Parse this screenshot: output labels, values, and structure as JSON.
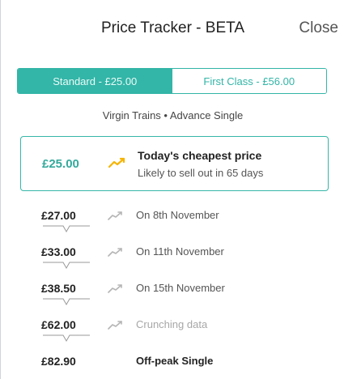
{
  "header": {
    "title": "Price Tracker - BETA",
    "close_label": "Close"
  },
  "tabs": [
    {
      "label": "Standard - £25.00",
      "active": true
    },
    {
      "label": "First Class - £56.00",
      "active": false
    }
  ],
  "subtitle": "Virgin Trains • Advance Single",
  "cheapest": {
    "price": "£25.00",
    "heading": "Today's cheapest price",
    "subtext": "Likely to sell out in 65 days",
    "icon": "trend-up-icon",
    "icon_color": "#f5b400"
  },
  "price_rows": [
    {
      "price": "£27.00",
      "label": "On 8th November",
      "icon": "trend-up-icon"
    },
    {
      "price": "£33.00",
      "label": "On 11th November",
      "icon": "trend-up-icon"
    },
    {
      "price": "£38.50",
      "label": "On 15th November",
      "icon": "trend-up-icon"
    },
    {
      "price": "£62.00",
      "label": "Crunching data",
      "icon": "trend-up-icon",
      "muted": true
    },
    {
      "price": "£82.90",
      "label": "Off-peak Single",
      "bold": true
    }
  ],
  "colors": {
    "accent": "#33b5a7",
    "cheapest_price": "#33a99b",
    "trend_grey": "#b5b5b5"
  }
}
